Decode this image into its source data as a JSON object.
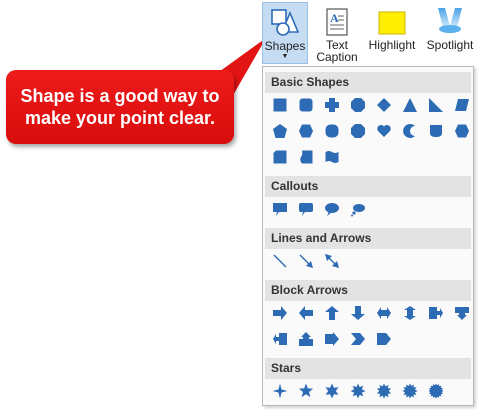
{
  "ribbon": {
    "shapes_label": "Shapes",
    "text_caption_label": "Text\nCaption",
    "highlight_label": "Highlight",
    "spotlight_label": "Spotlight",
    "colors": {
      "accent_blue": "#2e6bb5",
      "highlight_yellow": "#ffee00"
    }
  },
  "callout": {
    "line1": "Shape is a good way to",
    "line2": "make your point clear.",
    "color": "#e31414"
  },
  "panel": {
    "sections": [
      {
        "title": "Basic Shapes",
        "shapes": [
          "rectangle",
          "rounded-rectangle",
          "cross",
          "octagon",
          "diamond",
          "triangle",
          "right-triangle",
          "parallelogram",
          "pentagon",
          "hexagon",
          "circle-box",
          "rounded-octagon",
          "heart",
          "crescent",
          "shield",
          "hexagon-rounded",
          "snip-rectangle",
          "wave-left",
          "flag"
        ]
      },
      {
        "title": "Callouts",
        "shapes": [
          "rect-callout",
          "rounded-callout",
          "oval-callout",
          "cloud-callout"
        ]
      },
      {
        "title": "Lines and Arrows",
        "shapes": [
          "line",
          "arrow-line",
          "double-arrow-line"
        ]
      },
      {
        "title": "Block Arrows",
        "shapes": [
          "right-arrow",
          "left-arrow",
          "up-arrow",
          "down-arrow",
          "left-right-arrow",
          "up-down-arrow",
          "pentagon-right-callout",
          "down-arrow-callout",
          "left-arrow-callout",
          "up-arrow-callout",
          "right-arrow-pentagon",
          "chevron",
          "pentagon-arrow"
        ]
      },
      {
        "title": "Stars",
        "shapes": [
          "star-4",
          "star-5",
          "star-6",
          "star-8",
          "star-10",
          "star-12",
          "star-16"
        ]
      }
    ]
  }
}
